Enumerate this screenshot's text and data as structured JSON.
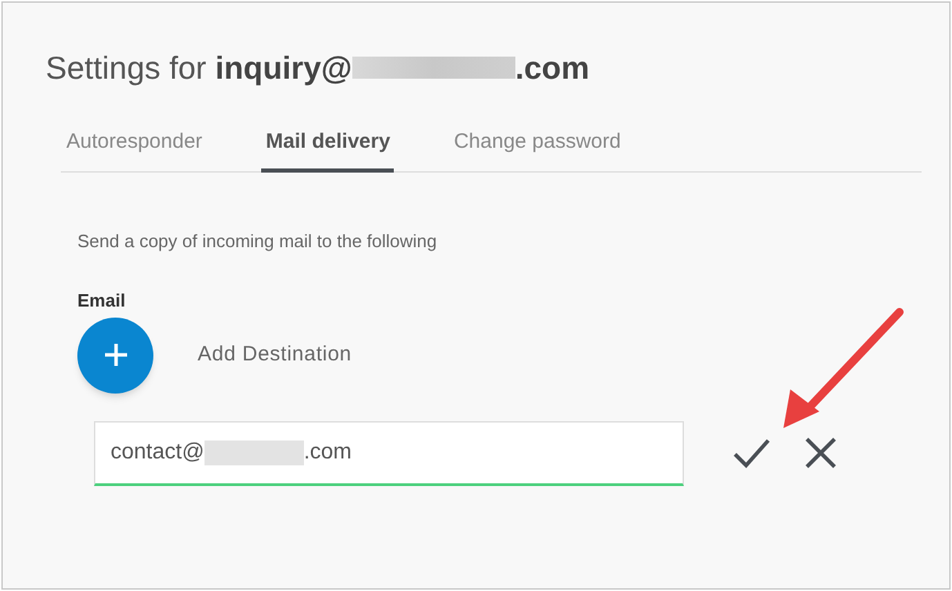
{
  "title": {
    "prefix": "Settings for",
    "account_start": "inquiry@",
    "account_end": ".com"
  },
  "tabs": [
    {
      "label": "Autoresponder",
      "selected": false
    },
    {
      "label": "Mail delivery",
      "selected": true
    },
    {
      "label": "Change password",
      "selected": false
    }
  ],
  "description": "Send a copy of incoming mail to the following",
  "email_label": "Email",
  "add_destination": {
    "label": "Add Destination"
  },
  "destination_field": {
    "value_start": "contact@",
    "value_end": ".com"
  }
}
